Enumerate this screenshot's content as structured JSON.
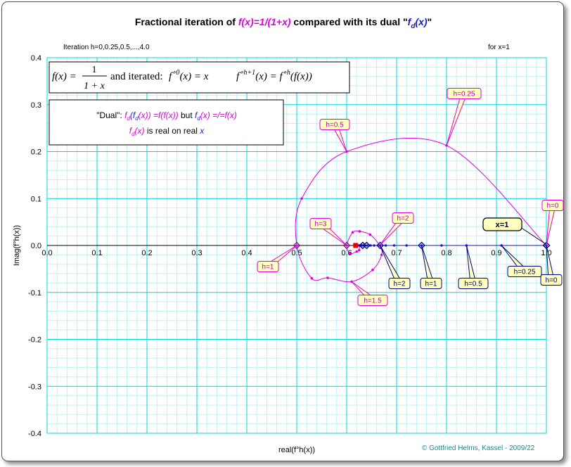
{
  "title": {
    "part1": "Fractional iteration of ",
    "part2": "f(x)=1/(1+x)",
    "part3": "  compared with its dual \"",
    "part4_f": "f",
    "part4_sub": "d",
    "part4_x": "(x)",
    "part5": "\""
  },
  "subtitle_left": "Iteration h=0,0.25,0.5,...,4.0",
  "subtitle_right": "for x=1",
  "xlabel": "real(f°h(x))",
  "ylabel": "Imag(f°h(x))",
  "copyright": "© Gottfried Helms, Kassel - 2009/22",
  "formula_box": {
    "lhs": "f(x) =",
    "num": "1",
    "den": "1 + x",
    "and_iterated": "and iterated:",
    "iter0_a": "f",
    "iter0_sup": "∘0",
    "iter0_b": "(x) = x",
    "iterh_a": "f",
    "iterh_sup": "∘h+1",
    "iterh_b": "(x) = f",
    "iterh_sup2": "∘h",
    "iterh_c": "(f(x))"
  },
  "dual_box": {
    "line1_a": "\"Dual\":  ",
    "line1_b": "f",
    "line1_bsub": "d",
    "line1_c": "(f",
    "line1_csub": "d",
    "line1_d": "(x)) =f(f(x))",
    "line1_e": "  but  ",
    "line1_f": "f",
    "line1_fsub": "d",
    "line1_g": "(x) =/=f(x)",
    "line2_a": "f",
    "line2_asub": "d",
    "line2_b": "(x)",
    "line2_c": "  is real on real ",
    "line2_d": "x"
  },
  "x1_label": "x=1",
  "colors": {
    "magenta": "#e000e0",
    "blue": "#1a1ad0",
    "navy": "#000080",
    "grid": "#00d8d8",
    "grid_minor": "#bff2f2",
    "callout_fill": "#ffffc0"
  },
  "chart_data": {
    "type": "scatter",
    "xlim": [
      0,
      1
    ],
    "ylim": [
      -0.4,
      0.4
    ],
    "x_ticks": [
      0.0,
      0.1,
      0.2,
      0.3,
      0.4,
      0.5,
      0.6,
      0.7,
      0.8,
      0.9,
      1.0
    ],
    "x_tick_labels": [
      "0.0",
      "0.1",
      "0.2",
      "0.3",
      "0.4",
      "0.5",
      "0.6",
      "0.7",
      "0.8",
      "0.9",
      "1.0"
    ],
    "y_ticks": [
      -0.4,
      -0.3,
      -0.2,
      -0.1,
      0.0,
      0.1,
      0.2,
      0.3,
      0.4
    ],
    "y_tick_labels": [
      "-0.4",
      "-0.3",
      "-0.2",
      "-0.1",
      "0.0",
      "0.1",
      "0.2",
      "0.3",
      "0.4"
    ],
    "grid": true,
    "series": [
      {
        "color": "#e000e0",
        "points": [
          [
            1.0,
            0.0
          ],
          [
            0.8,
            0.213
          ],
          [
            0.6,
            0.2
          ],
          [
            0.51,
            0.1
          ],
          [
            0.5,
            0.0
          ],
          [
            0.53,
            -0.07
          ],
          [
            0.562,
            -0.069
          ],
          [
            0.61,
            -0.077
          ],
          [
            0.652,
            -0.052
          ],
          [
            0.67,
            -0.02
          ],
          [
            0.666,
            0.0
          ],
          [
            0.647,
            0.023
          ],
          [
            0.626,
            0.03
          ],
          [
            0.612,
            0.028
          ],
          [
            0.6,
            0.0
          ],
          [
            0.607,
            -0.017
          ],
          [
            0.62,
            -0.013
          ],
          [
            0.625,
            -0.01
          ],
          [
            0.626,
            0.0
          ]
        ]
      },
      {
        "color": "#1a1ad0",
        "points": [
          [
            1.0,
            0.0
          ],
          [
            0.91,
            0.0
          ],
          [
            0.84,
            0.0
          ],
          [
            0.79,
            0.0
          ],
          [
            0.75,
            0.0
          ],
          [
            0.72,
            0.0
          ],
          [
            0.695,
            0.0
          ],
          [
            0.678,
            0.0
          ],
          [
            0.667,
            0.0
          ],
          [
            0.655,
            0.0
          ],
          [
            0.648,
            0.0
          ],
          [
            0.641,
            0.0
          ],
          [
            0.636,
            0.0
          ],
          [
            0.633,
            0.0
          ],
          [
            0.63,
            0.0
          ],
          [
            0.626,
            0.0
          ],
          [
            0.622,
            0.0
          ]
        ]
      }
    ],
    "magenta_markers": [
      [
        1.0,
        0.0
      ],
      [
        0.5,
        0.0
      ],
      [
        0.6,
        0.0
      ]
    ],
    "blue_markers": [
      [
        1.0,
        0.0
      ],
      [
        0.75,
        0.0
      ],
      [
        0.667,
        0.0
      ],
      [
        0.64,
        0.0
      ],
      [
        0.632,
        0.0
      ]
    ],
    "red_marker": [
      0.618,
      0.0
    ],
    "annotations_magenta": [
      {
        "label": "h=0",
        "x": 1.0,
        "y": 0.0
      },
      {
        "label": "h=0.25",
        "x": 0.8,
        "y": 0.213
      },
      {
        "label": "h=0.5",
        "x": 0.6,
        "y": 0.2
      },
      {
        "label": "h=1",
        "x": 0.5,
        "y": 0.0
      },
      {
        "label": "h=1.5",
        "x": 0.61,
        "y": -0.077
      },
      {
        "label": "h=2",
        "x": 0.666,
        "y": 0.0
      },
      {
        "label": "h=3",
        "x": 0.6,
        "y": 0.0
      }
    ],
    "annotations_blue": [
      {
        "label": "h=0",
        "x": 1.0,
        "y": 0.0
      },
      {
        "label": "h=0.25",
        "x": 0.91,
        "y": 0.0
      },
      {
        "label": "h=0.5",
        "x": 0.84,
        "y": 0.0
      },
      {
        "label": "h=1",
        "x": 0.75,
        "y": 0.0
      },
      {
        "label": "h=2",
        "x": 0.667,
        "y": 0.0
      }
    ]
  }
}
